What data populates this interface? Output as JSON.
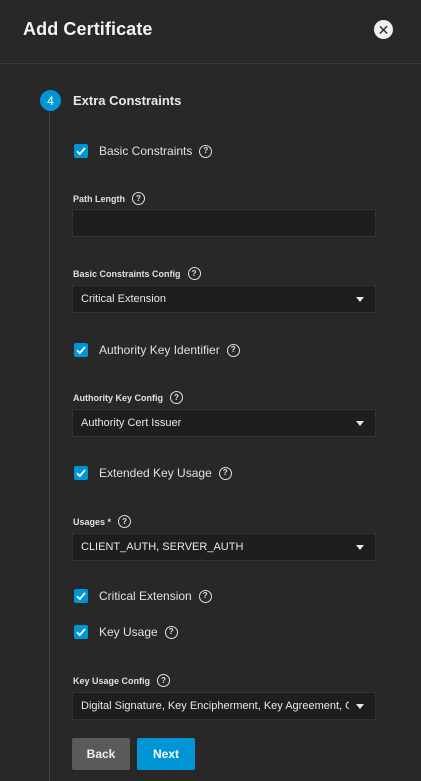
{
  "header": {
    "title": "Add Certificate",
    "close_icon": "close-icon"
  },
  "step": {
    "number": "4",
    "title": "Extra Constraints"
  },
  "basic_constraints": {
    "label": "Basic Constraints",
    "checked": true
  },
  "path_length": {
    "label": "Path Length",
    "value": ""
  },
  "basic_constraints_config": {
    "label": "Basic Constraints Config",
    "value": "Critical Extension"
  },
  "authority_key_identifier": {
    "label": "Authority Key Identifier",
    "checked": true
  },
  "authority_key_config": {
    "label": "Authority Key Config",
    "value": "Authority Cert Issuer"
  },
  "extended_key_usage": {
    "label": "Extended Key Usage",
    "checked": true
  },
  "usages": {
    "label": "Usages *",
    "value": "CLIENT_AUTH, SERVER_AUTH"
  },
  "critical_extension": {
    "label": "Critical Extension",
    "checked": true
  },
  "key_usage": {
    "label": "Key Usage",
    "checked": true
  },
  "key_usage_config": {
    "label": "Key Usage Config",
    "value": "Digital Signature, Key Encipherment, Key Agreement, C..."
  },
  "buttons": {
    "back": "Back",
    "next": "Next"
  },
  "help_glyph": "?",
  "colors": {
    "accent": "#0095d5",
    "background": "#282828",
    "input_bg": "#1e1e1e",
    "back_button": "#5a5a5a"
  }
}
